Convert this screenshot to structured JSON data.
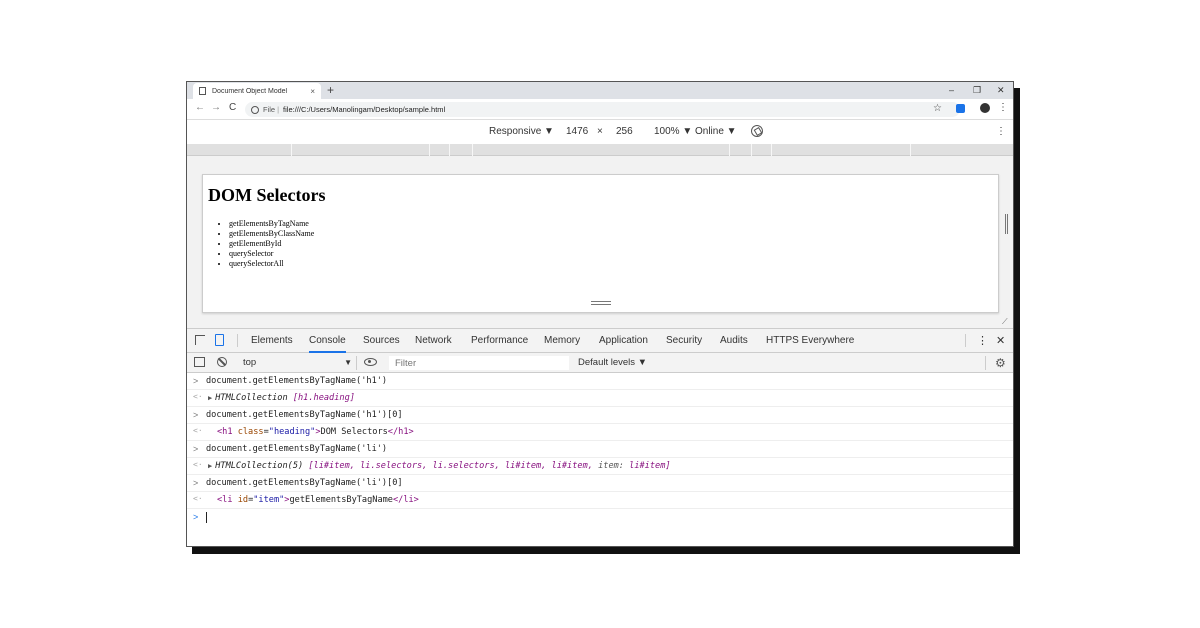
{
  "browser": {
    "tab_title": "Document Object Model",
    "tab_close": "×",
    "new_tab": "+",
    "window_controls": {
      "minimize": "–",
      "restore": "❐",
      "close": "✕"
    },
    "nav": {
      "back": "←",
      "forward": "→",
      "reload": "C"
    },
    "address": {
      "scheme": "File",
      "separator": "|",
      "url": "file:///C:/Users/Manolingam/Desktop/sample.html"
    },
    "star": "☆",
    "menu": "⋮"
  },
  "device_toolbar": {
    "mode": "Responsive ▼",
    "width": "1476",
    "times": "×",
    "height": "256",
    "zoom": "100% ▼",
    "network": "Online ▼",
    "menu": "⋮"
  },
  "page": {
    "heading": "DOM Selectors",
    "items": [
      "getElementsByTagName",
      "getElementsByClassName",
      "getElementById",
      "querySelector",
      "querySelectorAll"
    ]
  },
  "devtools": {
    "tabs": [
      "Elements",
      "Console",
      "Sources",
      "Network",
      "Performance",
      "Memory",
      "Application",
      "Security",
      "Audits",
      "HTTPS Everywhere"
    ],
    "active_tab": "Console",
    "menu": "⋮",
    "close": "✕",
    "context": "top",
    "context_arrow": "▼",
    "filter_placeholder": "Filter",
    "levels": "Default levels ▼",
    "gear": "⚙"
  },
  "console": {
    "prompt_symbol": ">",
    "result_symbol": "<·",
    "entries": [
      {
        "input": "document.getElementsByTagName('h1')",
        "output": "HTMLCollection [h1.heading]"
      },
      {
        "input": "document.getElementsByTagName('h1')[0]",
        "output": "<h1 class=\"heading\">DOM Selectors</h1>"
      },
      {
        "input": "document.getElementsByTagName('li')",
        "output": "HTMLCollection(5) [li#item, li.selectors, li.selectors, li#item, li#item, item: li#item]"
      },
      {
        "input": "document.getElementsByTagName('li')[0]",
        "output": "<li id=\"item\">getElementsByTagName</li>"
      }
    ],
    "out_parts": {
      "o1_prefix": "HTMLCollection ",
      "o1_value": "[h1.heading]",
      "o2_open": "<h1",
      "o2_attr": " class",
      "o2_eq": "=",
      "o2_val": "\"heading\"",
      "o2_gt": ">",
      "o2_text": "DOM Selectors",
      "o2_close": "</h1>",
      "o3_prefix": "HTMLCollection(5) ",
      "o3_list": "[li#item, li.selectors, li.selectors, li#item, li#item, ",
      "o3_key": "item:",
      "o3_last": " li#item]",
      "o4_open": "<li",
      "o4_attr": " id",
      "o4_eq": "=",
      "o4_val": "\"item\"",
      "o4_gt": ">",
      "o4_text": "getElementsByTagName",
      "o4_close": "</li>"
    }
  },
  "icons": {
    "doc": "document-icon",
    "inspect": "inspect-icon",
    "device": "device-toggle-icon",
    "sidebar": "console-sidebar-icon",
    "clear": "clear-console-icon",
    "eye": "live-expression-icon",
    "gear": "settings-gear-icon",
    "rotate": "rotate-icon"
  },
  "colors": {
    "accent": "#1a73e8",
    "tag": "#881280",
    "attr": "#994500",
    "attr_value": "#1a1aa6"
  }
}
